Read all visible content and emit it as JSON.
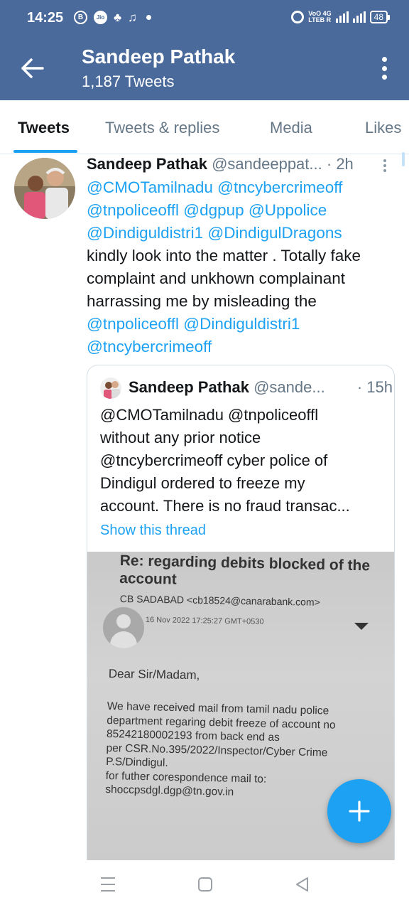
{
  "status_bar": {
    "time": "14:25",
    "left_icons": [
      "b-circle-icon",
      "jio-icon",
      "app-notification-icon",
      "bell-icon",
      "dot-icon"
    ],
    "network_label_top": "VoO 4G",
    "network_label_bottom": "LTEB R",
    "battery": "48"
  },
  "header": {
    "name": "Sandeep Pathak",
    "tweet_count": "1,187 Tweets",
    "colors": {
      "background": "#4a6a9c",
      "text": "#ffffff"
    }
  },
  "tabs": [
    {
      "label": "Tweets",
      "active": true
    },
    {
      "label": "Tweets & replies",
      "active": false
    },
    {
      "label": "Media",
      "active": false
    },
    {
      "label": "Likes",
      "active": false
    }
  ],
  "tweet": {
    "author_name": "Sandeep Pathak",
    "author_handle": "@sandeeppat...",
    "time": "· 2h",
    "mentions_line1": "@CMOTamilnadu @tncybercrimeoff",
    "mentions_line2": "@tnpoliceoffl @dgpup @Uppolice",
    "mentions_line3": "@Dindiguldistri1 @DindigulDragons",
    "text_line1": "kindly look into the matter . Totally fake",
    "text_line2": "complaint and unkhown complainant",
    "text_line3": "harrassing me by misleading the",
    "mentions_line4": "@tnpoliceoffl @Dindiguldistri1",
    "mentions_line5": "@tncybercrimeoff"
  },
  "quoted_tweet": {
    "author_name": "Sandeep Pathak",
    "author_handle": "@sande...",
    "time": "· 15h",
    "lines": [
      "@CMOTamilnadu @tnpoliceoffl",
      "without any prior notice",
      "@tncybercrimeoff cyber police of",
      "Dindigul ordered to freeze my",
      "account. There is no fraud transac..."
    ],
    "show_thread": "Show this thread",
    "image": {
      "subject_line1": "Re: regarding debits blocked of the",
      "subject_line2": "account",
      "sender": "CB SADABAD <cb18524@canarabank.com>",
      "date": "16 Nov 2022 17:25:27 GMT+0530",
      "greeting": "Dear Sir/Madam,",
      "body": [
        "We have received mail from tamil nadu police",
        "department regaring debit freeze of account no",
        "85242180002193 from back end as",
        "per CSR.No.395/2022/Inspector/Cyber Crime",
        "P.S/Dindigul.",
        "for futher corespondence mail to:",
        "shoccpsdgl.dgp@tn.gov.in"
      ]
    }
  },
  "fab": {
    "icon": "plus-icon",
    "color": "#1da1f2"
  },
  "nav_bar": {
    "icons": [
      "recent-apps-icon",
      "home-icon",
      "back-triangle-icon"
    ]
  },
  "colors": {
    "link": "#1da1f2",
    "secondary_text": "#657786"
  }
}
